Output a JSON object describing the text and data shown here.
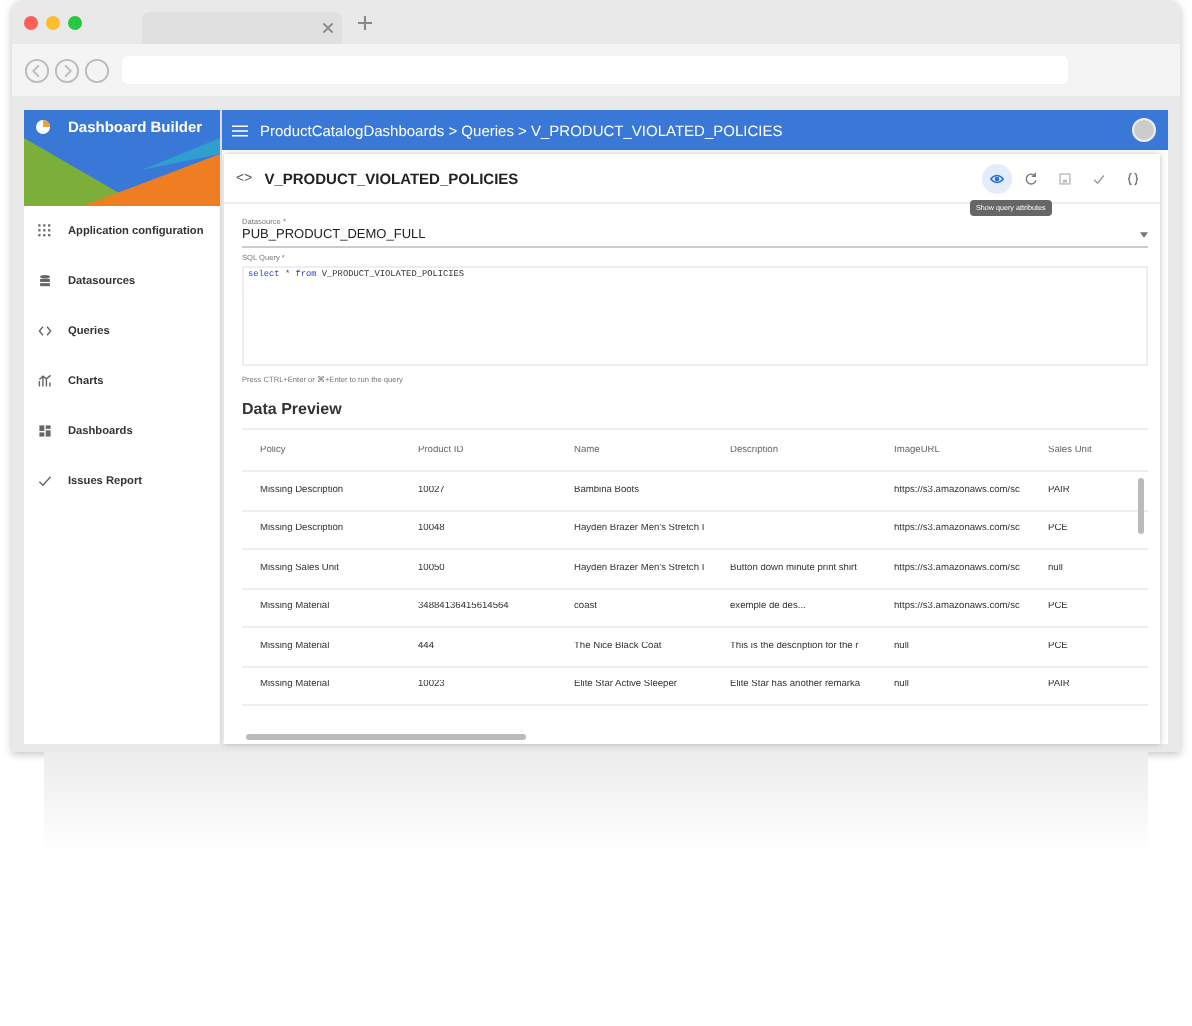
{
  "app": {
    "title": "Dashboard Builder",
    "breadcrumb": "ProductCatalogDashboards > Queries > V_PRODUCT_VIOLATED_POLICIES"
  },
  "sidebar": {
    "items": [
      {
        "kind": "grid",
        "label": "Application configuration"
      },
      {
        "kind": "database",
        "label": "Datasources"
      },
      {
        "kind": "code",
        "label": "Queries"
      },
      {
        "kind": "chart",
        "label": "Charts"
      },
      {
        "kind": "dashboard",
        "label": "Dashboards"
      },
      {
        "kind": "check",
        "label": "Issues Report"
      }
    ]
  },
  "editor": {
    "icon": "<>",
    "title": "V_PRODUCT_VIOLATED_POLICIES",
    "toolbar": [
      {
        "kind": "eye",
        "active": true
      },
      {
        "kind": "refresh",
        "active": false
      },
      {
        "kind": "save",
        "active": false
      },
      {
        "kind": "check",
        "active": false
      },
      {
        "kind": "braces",
        "active": false
      }
    ],
    "tooltip": "Show query attributes",
    "datasource": {
      "label": "Datasource *",
      "value": "PUB_PRODUCT_DEMO_FULL"
    },
    "query": {
      "label": "SQL Query *",
      "keyword1": "select",
      "rest": " * ",
      "keyword2": "from",
      "table": " V_PRODUCT_VIOLATED_POLICIES"
    },
    "hint": "Press CTRL+Enter or ⌘+Enter to run the query"
  },
  "preview": {
    "title": "Data Preview",
    "columns": [
      "Policy",
      "Product ID",
      "Name",
      "Description",
      "ImageURL",
      "Sales Unit"
    ],
    "rows": [
      [
        "Missing Description",
        "10027",
        "Bambina Boots",
        "",
        "https://s3.amazonaws.com/sc",
        "PAIR"
      ],
      [
        "Missing Description",
        "10048",
        "Hayden Brazer Men's Stretch I",
        "",
        "https://s3.amazonaws.com/sc",
        "PCE"
      ],
      [
        "Missing Sales Unit",
        "10050",
        "Hayden Brazer Men's Stretch I",
        "Button down minute print shirt",
        "https://s3.amazonaws.com/sc",
        "null"
      ],
      [
        "Missing Material",
        "34884136415614564",
        "coast",
        "exemple de des...",
        "https://s3.amazonaws.com/sc",
        "PCE"
      ],
      [
        "Missing Material",
        "444",
        "The Nice Black Coat",
        "This is the description for the r",
        "null",
        "PCE"
      ],
      [
        "Missing Material",
        "10023",
        "Elite Star Active Sleeper",
        "Elite Star has another remarka",
        "null",
        "PAIR"
      ]
    ]
  }
}
